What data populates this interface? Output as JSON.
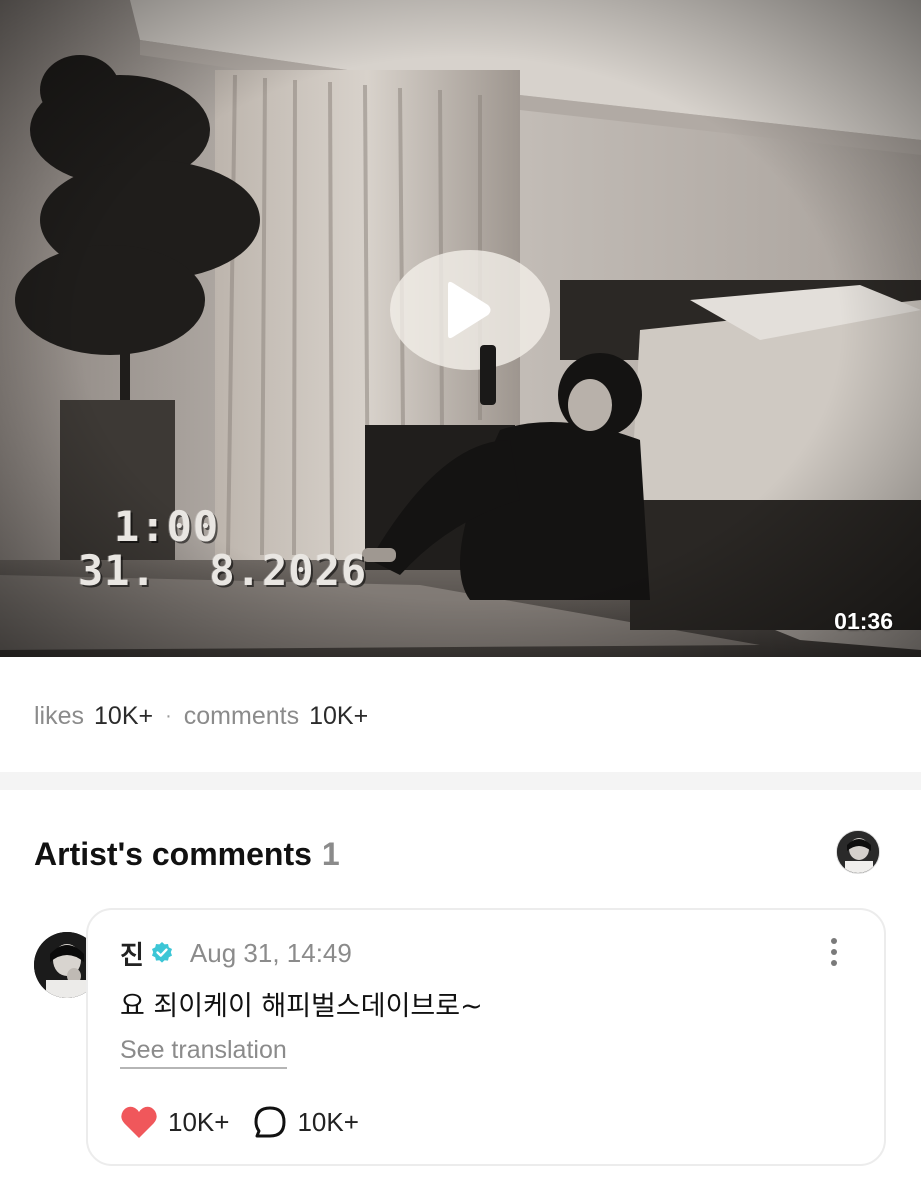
{
  "video": {
    "stamp_time": "1:00",
    "stamp_date": "31.  8.2026",
    "duration": "01:36",
    "play_icon": "play-icon"
  },
  "stats": {
    "likes_label": "likes",
    "likes_value": "10K+",
    "separator": "·",
    "comments_label": "comments",
    "comments_value": "10K+"
  },
  "artist_comments": {
    "title": "Artist's comments",
    "count": "1",
    "comment": {
      "author": "진",
      "verified_icon": "verified-badge-icon",
      "timestamp": "Aug 31, 14:49",
      "text": "요 죄이케이 해피벌스데이브로~",
      "translate_label": "See translation",
      "like_count": "10K+",
      "reply_count": "10K+"
    }
  },
  "colors": {
    "like_heart": "#f0575b",
    "verified_badge": "#3cc6d6",
    "muted_text": "#8b8b8b"
  }
}
